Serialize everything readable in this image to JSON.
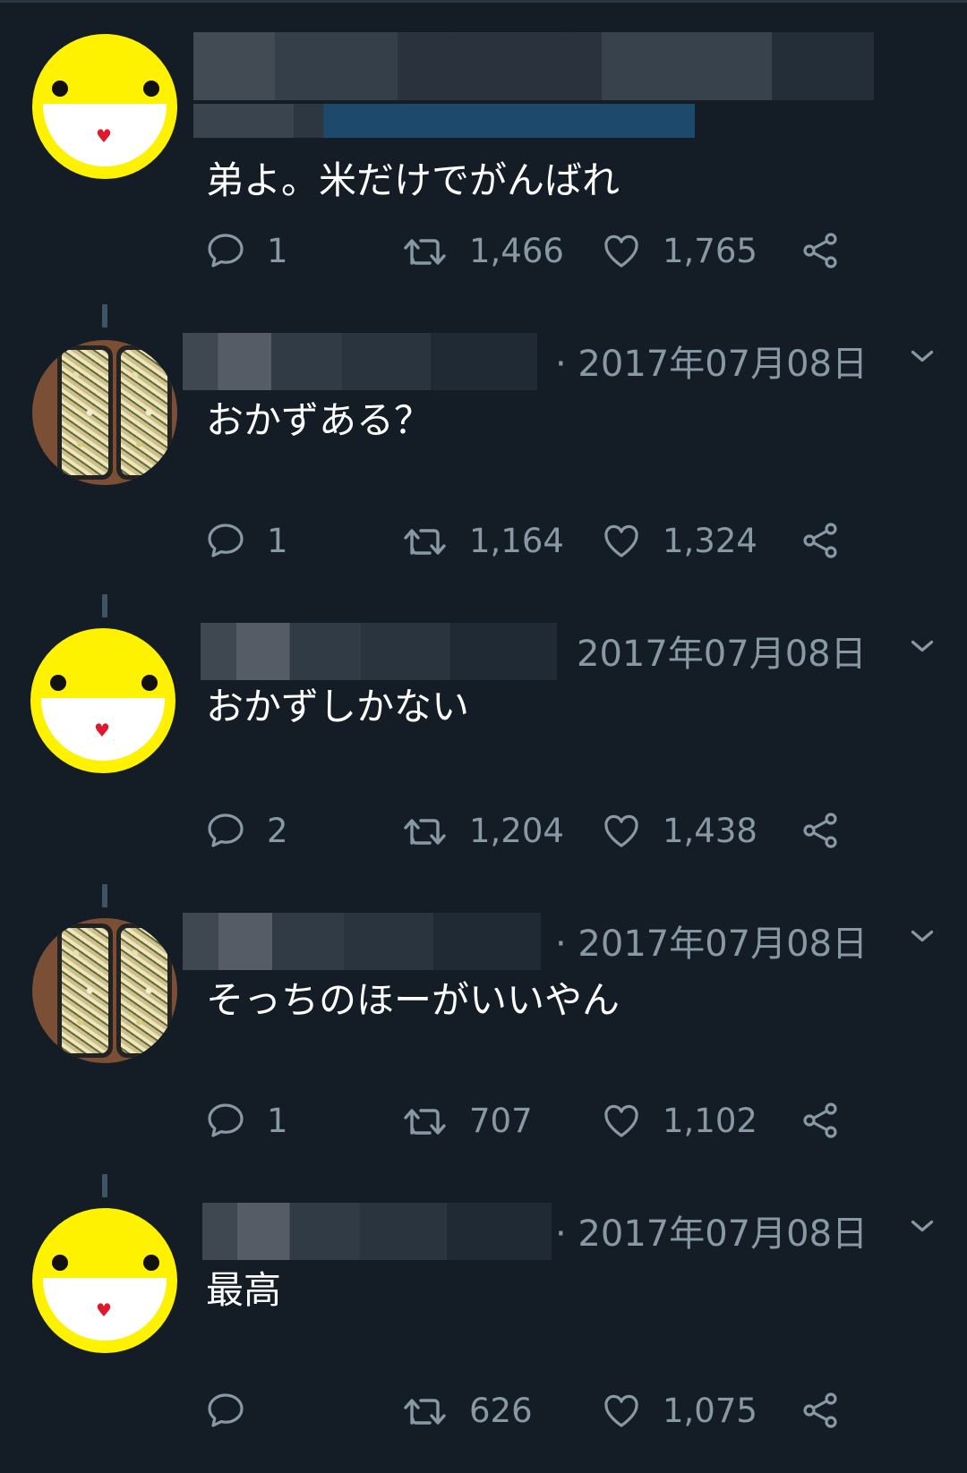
{
  "tweets": [
    {
      "avatar": "smiley-face",
      "timestamp": "",
      "text": "弟よ。米だけでがんばれ",
      "replies": "1",
      "retweets": "1,466",
      "likes": "1,765"
    },
    {
      "avatar": "food-photo",
      "timestamp": "· 2017年07月08日",
      "text": "おかずある？",
      "replies": "1",
      "retweets": "1,164",
      "likes": "1,324"
    },
    {
      "avatar": "smiley-face",
      "timestamp": "2017年07月08日",
      "text": "おかずしかない",
      "replies": "2",
      "retweets": "1,204",
      "likes": "1,438"
    },
    {
      "avatar": "food-photo",
      "timestamp": "· 2017年07月08日",
      "text": "そっちのほーがいいやん",
      "replies": "1",
      "retweets": "707",
      "likes": "1,102"
    },
    {
      "avatar": "smiley-face",
      "timestamp": "· 2017年07月08日",
      "text": "最高",
      "replies": "",
      "retweets": "626",
      "likes": "1,075"
    }
  ],
  "icons": {
    "reply": "reply-icon",
    "retweet": "retweet-icon",
    "like": "heart-icon",
    "share": "share-icon",
    "menu": "chevron-down-icon"
  },
  "colors": {
    "background": "#141d26",
    "muted": "#8899a6",
    "thread_line": "#3d5466",
    "avatar_yellow": "#fff200"
  }
}
